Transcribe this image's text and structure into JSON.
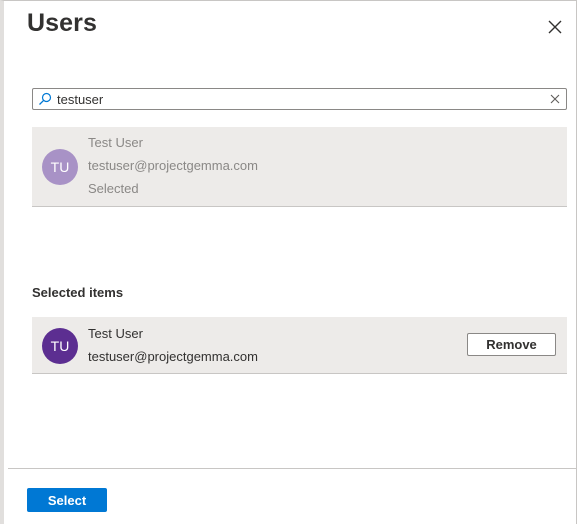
{
  "panel": {
    "title": "Users"
  },
  "search": {
    "value": "testuser",
    "placeholder": ""
  },
  "results": [
    {
      "initials": "TU",
      "name": "Test User",
      "email": "testuser@projectgemma.com",
      "status": "Selected",
      "avatar_color": "#a892c6"
    }
  ],
  "selected_section": {
    "heading": "Selected items",
    "items": [
      {
        "initials": "TU",
        "name": "Test User",
        "email": "testuser@projectgemma.com",
        "remove_label": "Remove",
        "avatar_color": "#5c2e91"
      }
    ]
  },
  "footer": {
    "select_label": "Select"
  },
  "colors": {
    "accent": "#0078d4",
    "row_background": "#edebe9",
    "muted_text": "#8a8886"
  },
  "icons": {
    "close": "close-icon",
    "search": "search-icon",
    "clear": "clear-icon"
  }
}
